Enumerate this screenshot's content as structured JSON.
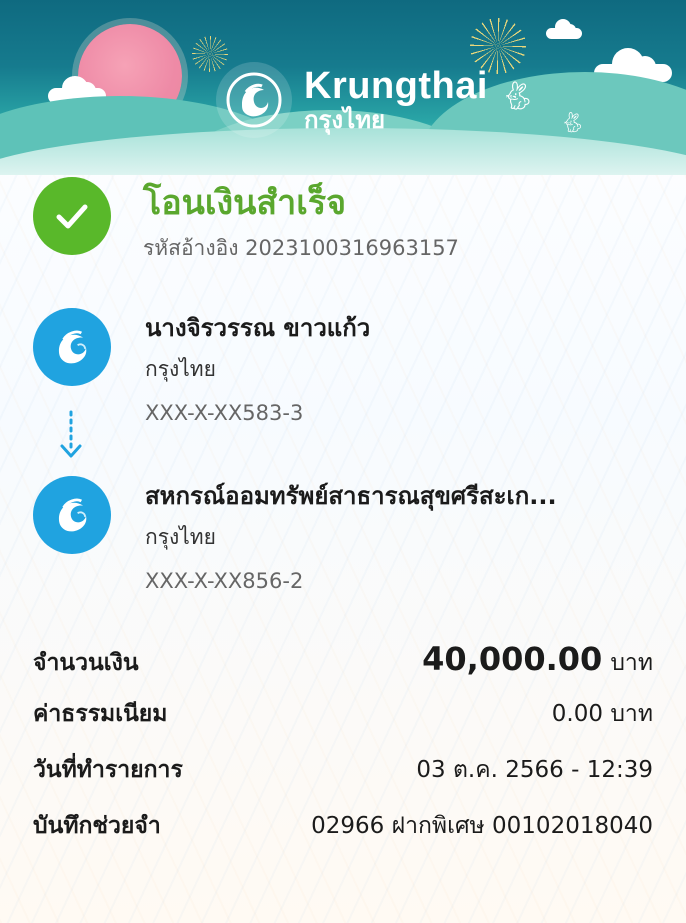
{
  "brand": {
    "name_en": "Krungthai",
    "name_th": "กรุงไทย"
  },
  "status": {
    "title": "โอนเงินสำเร็จ",
    "reference": "รหัสอ้างอิง 2023100316963157",
    "icon": "check-icon",
    "color": "#59b82a"
  },
  "sender": {
    "name": "นางจิรวรรณ ขาวแก้ว",
    "bank": "กรุงไทย",
    "account": "XXX-X-XX583-3",
    "icon": "krungthai-logo-icon"
  },
  "receiver": {
    "name": "สหกรณ์ออมทรัพย์สาธารณสุขศรีสะเก...",
    "bank": "กรุงไทย",
    "account": "XXX-X-XX856-2",
    "icon": "krungthai-logo-icon"
  },
  "details": {
    "amount_label": "จำนวนเงิน",
    "amount_value": "40,000.00",
    "amount_unit": "บาท",
    "fee_label": "ค่าธรรมเนียม",
    "fee_value": "0.00 บาท",
    "date_label": "วันที่ทำรายการ",
    "date_value": "03 ต.ค. 2566 - 12:39",
    "memo_label": "บันทึกช่วยจำ",
    "memo_value": "02966 ฝากพิเศษ 00102018040"
  },
  "colors": {
    "brand_blue": "#20a3e0",
    "success_green": "#59b82a",
    "banner_teal": "#167b8e"
  }
}
